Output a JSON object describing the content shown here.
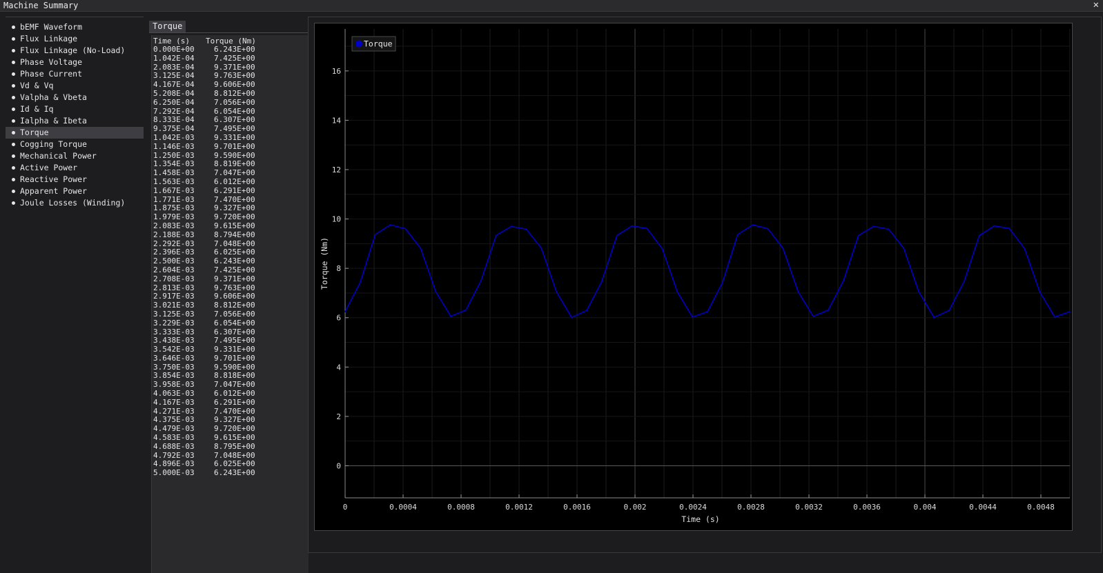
{
  "window": {
    "title": "Machine Summary",
    "close_glyph": "✕"
  },
  "sidebar": {
    "items": [
      {
        "label": "bEMF Waveform"
      },
      {
        "label": "Flux Linkage"
      },
      {
        "label": "Flux Linkage (No-Load)"
      },
      {
        "label": "Phase Voltage"
      },
      {
        "label": "Phase Current"
      },
      {
        "label": "Vd & Vq"
      },
      {
        "label": "Valpha & Vbeta"
      },
      {
        "label": "Id & Iq"
      },
      {
        "label": "Ialpha & Ibeta"
      },
      {
        "label": "Torque",
        "active": true
      },
      {
        "label": "Cogging Torque"
      },
      {
        "label": "Mechanical Power"
      },
      {
        "label": "Active Power"
      },
      {
        "label": "Reactive Power"
      },
      {
        "label": "Apparent Power"
      },
      {
        "label": "Joule Losses (Winding)"
      }
    ]
  },
  "table": {
    "tab_label": "Torque",
    "headers": [
      "Time (s)",
      "Torque (Nm)"
    ],
    "rows": [
      [
        "0.000E+00",
        "6.243E+00"
      ],
      [
        "1.042E-04",
        "7.425E+00"
      ],
      [
        "2.083E-04",
        "9.371E+00"
      ],
      [
        "3.125E-04",
        "9.763E+00"
      ],
      [
        "4.167E-04",
        "9.606E+00"
      ],
      [
        "5.208E-04",
        "8.812E+00"
      ],
      [
        "6.250E-04",
        "7.056E+00"
      ],
      [
        "7.292E-04",
        "6.054E+00"
      ],
      [
        "8.333E-04",
        "6.307E+00"
      ],
      [
        "9.375E-04",
        "7.495E+00"
      ],
      [
        "1.042E-03",
        "9.331E+00"
      ],
      [
        "1.146E-03",
        "9.701E+00"
      ],
      [
        "1.250E-03",
        "9.590E+00"
      ],
      [
        "1.354E-03",
        "8.819E+00"
      ],
      [
        "1.458E-03",
        "7.047E+00"
      ],
      [
        "1.563E-03",
        "6.012E+00"
      ],
      [
        "1.667E-03",
        "6.291E+00"
      ],
      [
        "1.771E-03",
        "7.470E+00"
      ],
      [
        "1.875E-03",
        "9.327E+00"
      ],
      [
        "1.979E-03",
        "9.720E+00"
      ],
      [
        "2.083E-03",
        "9.615E+00"
      ],
      [
        "2.188E-03",
        "8.794E+00"
      ],
      [
        "2.292E-03",
        "7.048E+00"
      ],
      [
        "2.396E-03",
        "6.025E+00"
      ],
      [
        "2.500E-03",
        "6.243E+00"
      ],
      [
        "2.604E-03",
        "7.425E+00"
      ],
      [
        "2.708E-03",
        "9.371E+00"
      ],
      [
        "2.813E-03",
        "9.763E+00"
      ],
      [
        "2.917E-03",
        "9.606E+00"
      ],
      [
        "3.021E-03",
        "8.812E+00"
      ],
      [
        "3.125E-03",
        "7.056E+00"
      ],
      [
        "3.229E-03",
        "6.054E+00"
      ],
      [
        "3.333E-03",
        "6.307E+00"
      ],
      [
        "3.438E-03",
        "7.495E+00"
      ],
      [
        "3.542E-03",
        "9.331E+00"
      ],
      [
        "3.646E-03",
        "9.701E+00"
      ],
      [
        "3.750E-03",
        "9.590E+00"
      ],
      [
        "3.854E-03",
        "8.818E+00"
      ],
      [
        "3.958E-03",
        "7.047E+00"
      ],
      [
        "4.063E-03",
        "6.012E+00"
      ],
      [
        "4.167E-03",
        "6.291E+00"
      ],
      [
        "4.271E-03",
        "7.470E+00"
      ],
      [
        "4.375E-03",
        "9.327E+00"
      ],
      [
        "4.479E-03",
        "9.720E+00"
      ],
      [
        "4.583E-03",
        "9.615E+00"
      ],
      [
        "4.688E-03",
        "8.795E+00"
      ],
      [
        "4.792E-03",
        "7.048E+00"
      ],
      [
        "4.896E-03",
        "6.025E+00"
      ],
      [
        "5.000E-03",
        "6.243E+00"
      ]
    ]
  },
  "colors": {
    "series": "#0000c8",
    "background": "#000000",
    "panel": "#2a2a2c"
  },
  "chart_data": {
    "type": "line",
    "xlabel": "Time (s)",
    "ylabel": "Torque (Nm)",
    "xlim": [
      0,
      0.005
    ],
    "ylim": [
      -1.3,
      17.7
    ],
    "x_ticks": [
      "0",
      "0.0004",
      "0.0008",
      "0.0012",
      "0.0016",
      "0.002",
      "0.0024",
      "0.0028",
      "0.0032",
      "0.0036",
      "0.004",
      "0.0044",
      "0.0048"
    ],
    "y_ticks": [
      "0",
      "2",
      "4",
      "6",
      "8",
      "10",
      "12",
      "14",
      "16"
    ],
    "legend": "top-left",
    "series": [
      {
        "name": "Torque",
        "color": "#0000c8",
        "x": [
          0,
          0.0001042,
          0.0002083,
          0.0003125,
          0.0004167,
          0.0005208,
          0.000625,
          0.0007292,
          0.0008333,
          0.0009375,
          0.001042,
          0.001146,
          0.00125,
          0.001354,
          0.001458,
          0.001563,
          0.001667,
          0.001771,
          0.001875,
          0.001979,
          0.002083,
          0.002188,
          0.002292,
          0.002396,
          0.0025,
          0.002604,
          0.002708,
          0.002813,
          0.002917,
          0.003021,
          0.003125,
          0.003229,
          0.003333,
          0.003438,
          0.003542,
          0.003646,
          0.00375,
          0.003854,
          0.003958,
          0.004063,
          0.004167,
          0.004271,
          0.004375,
          0.004479,
          0.004583,
          0.004688,
          0.004792,
          0.004896,
          0.005
        ],
        "y": [
          6.243,
          7.425,
          9.371,
          9.763,
          9.606,
          8.812,
          7.056,
          6.054,
          6.307,
          7.495,
          9.331,
          9.701,
          9.59,
          8.819,
          7.047,
          6.012,
          6.291,
          7.47,
          9.327,
          9.72,
          9.615,
          8.794,
          7.048,
          6.025,
          6.243,
          7.425,
          9.371,
          9.763,
          9.606,
          8.812,
          7.056,
          6.054,
          6.307,
          7.495,
          9.331,
          9.701,
          9.59,
          8.818,
          7.047,
          6.012,
          6.291,
          7.47,
          9.327,
          9.72,
          9.615,
          8.795,
          7.048,
          6.025,
          6.243
        ]
      }
    ]
  }
}
